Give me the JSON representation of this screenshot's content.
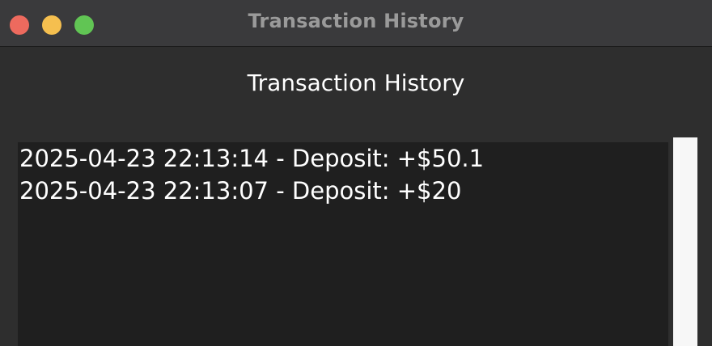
{
  "window": {
    "title": "Transaction History"
  },
  "main": {
    "heading": "Transaction History",
    "transactions": [
      "2025-04-23 22:13:14 - Deposit: +$50.1",
      "2025-04-23 22:13:07 - Deposit: +$20"
    ]
  },
  "colors": {
    "close": "#ed6a5e",
    "minimize": "#f5bf4f",
    "maximize": "#61c554",
    "background": "#2e2e2e",
    "list_background": "#1f1f1f"
  }
}
